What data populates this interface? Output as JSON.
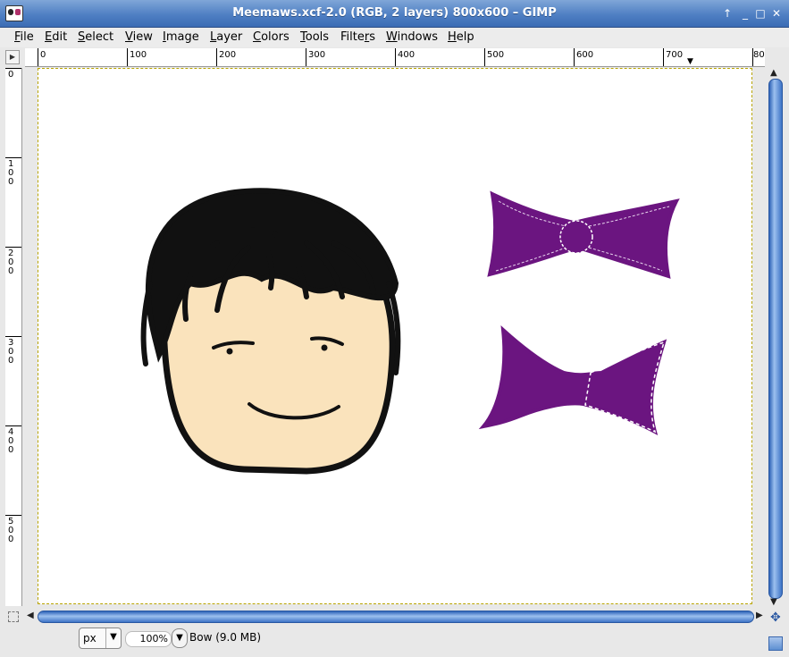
{
  "window": {
    "title": "Meemaws.xcf-2.0 (RGB, 2 layers) 800x600 – GIMP",
    "controls": [
      "↑",
      "_",
      "□",
      "✕"
    ]
  },
  "menu": [
    {
      "label": "File",
      "mnemonic": "F",
      "rest": "ile"
    },
    {
      "label": "Edit",
      "mnemonic": "E",
      "rest": "dit"
    },
    {
      "label": "Select",
      "mnemonic": "S",
      "rest": "elect"
    },
    {
      "label": "View",
      "mnemonic": "V",
      "rest": "iew"
    },
    {
      "label": "Image",
      "mnemonic": "I",
      "rest": "mage"
    },
    {
      "label": "Layer",
      "mnemonic": "L",
      "rest": "ayer"
    },
    {
      "label": "Colors",
      "mnemonic": "C",
      "rest": "olors"
    },
    {
      "label": "Tools",
      "mnemonic": "T",
      "rest": "ools"
    },
    {
      "label": "Filters",
      "mnemonic": "r",
      "rest": ""
    },
    {
      "label": "Windows",
      "mnemonic": "W",
      "rest": "indows"
    },
    {
      "label": "Help",
      "mnemonic": "H",
      "rest": "elp"
    }
  ],
  "rulers": {
    "horizontal_labels": [
      "0",
      "100",
      "200",
      "300",
      "400",
      "500",
      "600",
      "700",
      "80"
    ],
    "vertical_labels": [
      "0",
      "100",
      "200",
      "300",
      "400",
      "500"
    ]
  },
  "canvas": {
    "background": "#ffffff",
    "skin_color": "#fae3bc",
    "hair_color": "#111111",
    "bow_color": "#6b1580"
  },
  "statusbar": {
    "unit": "px",
    "zoom": "100",
    "zoom_suffix": "%",
    "status": "Bow (9.0 MB)"
  },
  "icons": {
    "app": "gimp-icon",
    "ruler_corner": "quick-menu-icon",
    "navigate": "navigate-icon",
    "quick_mask": "quick-mask-icon"
  }
}
